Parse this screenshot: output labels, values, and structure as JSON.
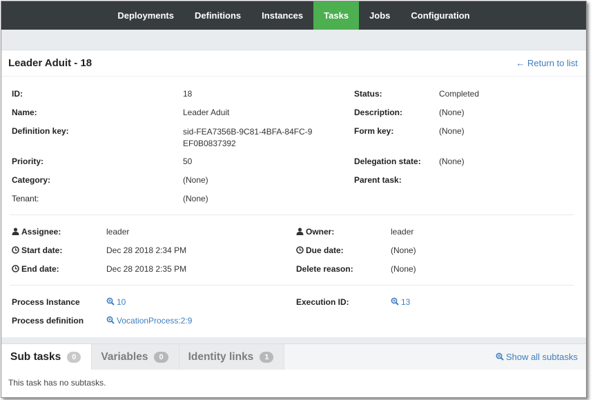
{
  "nav": {
    "items": [
      {
        "label": "Deployments"
      },
      {
        "label": "Definitions"
      },
      {
        "label": "Instances"
      },
      {
        "label": "Tasks"
      },
      {
        "label": "Jobs"
      },
      {
        "label": "Configuration"
      }
    ],
    "active": "Tasks"
  },
  "task": {
    "title": "Leader Aduit - 18",
    "return_link": "← Return to list",
    "id_label": "ID:",
    "id_value": "18",
    "name_label": "Name:",
    "name_value": "Leader Aduit",
    "defkey_label": "Definition key:",
    "defkey_value": "sid-FEA7356B-9C81-4BFA-84FC-9EF0B0837392",
    "priority_label": "Priority:",
    "priority_value": "50",
    "category_label": "Category:",
    "category_value": "(None)",
    "tenant_label": "Tenant:",
    "tenant_value": "(None)",
    "status_label": "Status:",
    "status_value": "Completed",
    "description_label": "Description:",
    "description_value": "(None)",
    "formkey_label": "Form key:",
    "formkey_value": "(None)",
    "delegation_label": "Delegation state:",
    "delegation_value": "(None)",
    "parent_label": "Parent task:"
  },
  "people": {
    "assignee_label": "Assignee:",
    "assignee_value": "leader",
    "start_label": "Start date:",
    "start_value": "Dec 28 2018 2:34 PM",
    "end_label": "End date:",
    "end_value": "Dec 28 2018 2:35 PM",
    "owner_label": "Owner:",
    "owner_value": "leader",
    "due_label": "Due date:",
    "due_value": "(None)",
    "delete_label": "Delete reason:",
    "delete_value": "(None)"
  },
  "process": {
    "instance_label": "Process Instance",
    "instance_value": "10",
    "definition_label": "Process definition",
    "definition_value": "VocationProcess:2:9",
    "execution_label": "Execution ID:",
    "execution_value": "13"
  },
  "tabs": {
    "items": [
      {
        "label": "Sub tasks",
        "count": "0"
      },
      {
        "label": "Variables",
        "count": "0"
      },
      {
        "label": "Identity links",
        "count": "1"
      }
    ],
    "show_all": "Show all subtasks",
    "empty_message": "This task has no subtasks."
  },
  "colors": {
    "nav_bg": "#373d3f",
    "active_tab": "#4caf50",
    "link": "#3d7ec0"
  }
}
